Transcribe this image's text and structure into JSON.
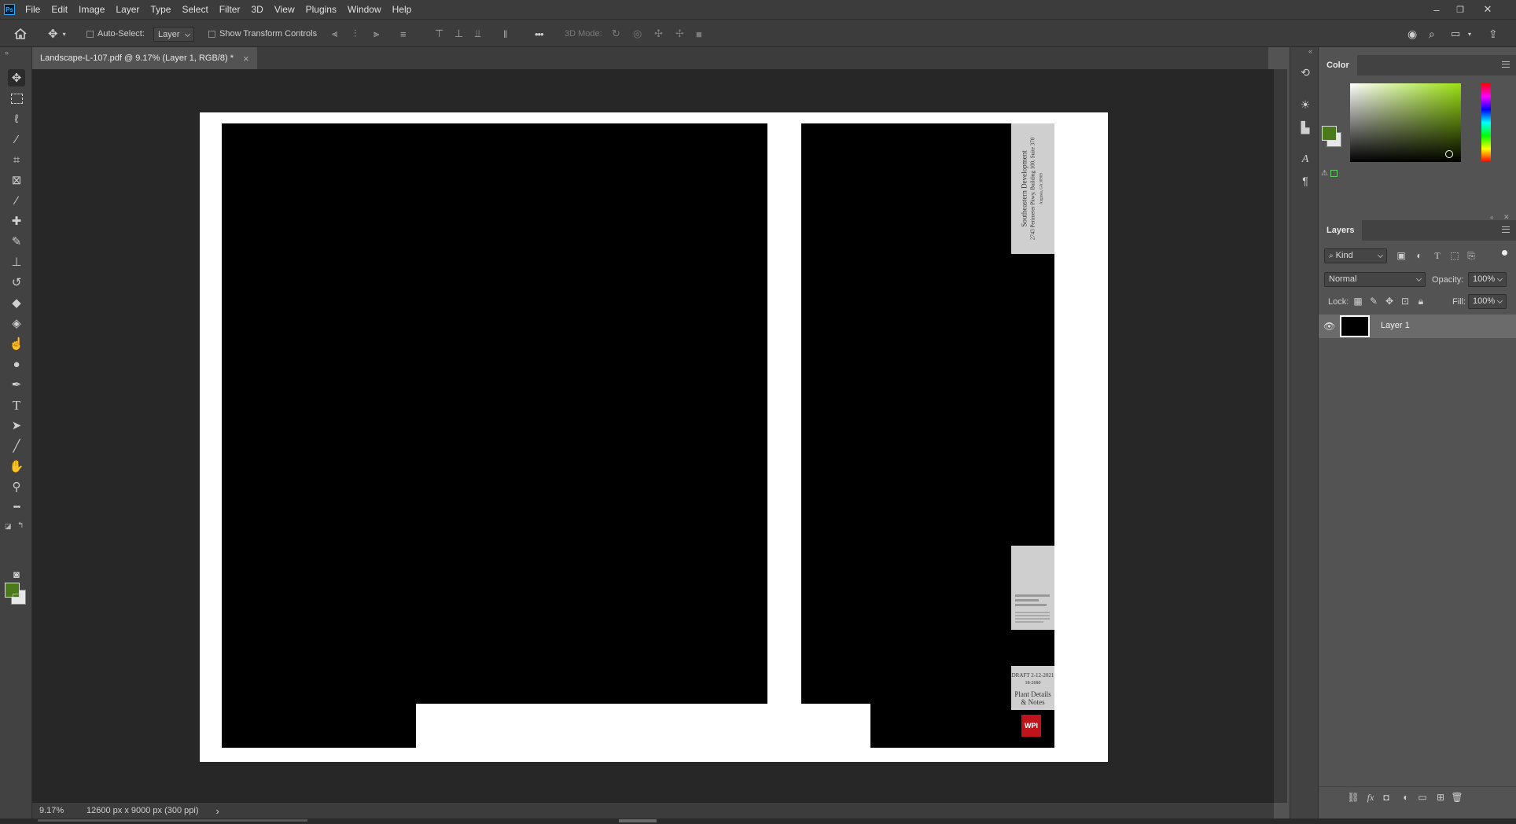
{
  "app": {
    "logo": "Ps"
  },
  "menu": [
    "File",
    "Edit",
    "Image",
    "Layer",
    "Type",
    "Select",
    "Filter",
    "3D",
    "View",
    "Plugins",
    "Window",
    "Help"
  ],
  "window_controls": {
    "minimize": "–",
    "restore": "❐",
    "close": "✕"
  },
  "options": {
    "auto_select_label": "Auto-Select:",
    "auto_select_value": "Layer",
    "show_transform_label": "Show Transform Controls",
    "more": "•••",
    "mode_3d_label": "3D Mode:"
  },
  "document": {
    "tab_title": "Landscape-L-107.pdf @ 9.17% (Layer 1, RGB/8) *",
    "close_glyph": "×"
  },
  "titleblock": {
    "company": "Southeastern Development",
    "address": "2743 Perimeter Pkwy, Building 100, Suite 370",
    "city": "Augusta, GA 30909",
    "draft": "DRAFT 2-12-2021",
    "project_number": "18-2680",
    "sheet_title_1": "Plant Details",
    "sheet_title_2": "& Notes",
    "logo": "WPI"
  },
  "status": {
    "zoom": "9.17%",
    "doc_size": "12600 px x 9000 px (300 ppi)",
    "arrow": "›"
  },
  "panels": {
    "color": {
      "tab": "Color",
      "foreground": "#4b7a1a",
      "background": "#e8e8e8",
      "hue": "#9be010"
    },
    "layers": {
      "tab": "Layers",
      "filter_kind": "Kind",
      "blend_mode": "Normal",
      "opacity_label": "Opacity:",
      "opacity_value": "100%",
      "lock_label": "Lock:",
      "fill_label": "Fill:",
      "fill_value": "100%",
      "items": [
        {
          "name": "Layer 1",
          "visible": true
        }
      ],
      "bottom_fx": "fx"
    }
  },
  "tool_icons": [
    "move-icon",
    "rectangular-marquee-icon",
    "lasso-icon",
    "magic-wand-icon",
    "crop-icon",
    "frame-icon",
    "eyedropper-icon",
    "healing-brush-icon",
    "brush-icon",
    "clone-stamp-icon",
    "history-brush-icon",
    "eraser-icon",
    "paint-bucket-icon",
    "smudge-icon",
    "dodge-icon",
    "pen-icon",
    "type-icon",
    "path-selection-icon",
    "line-icon",
    "hand-icon",
    "zoom-icon",
    "more-tools-icon"
  ],
  "colors": {
    "fg_swatch": "#4b7a1a",
    "bg_swatch": "#e8e8e8",
    "wpi_red": "#c0141c"
  }
}
